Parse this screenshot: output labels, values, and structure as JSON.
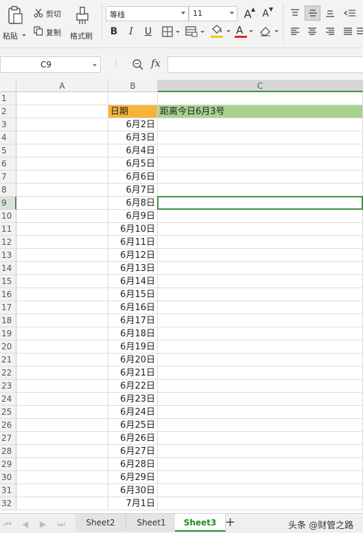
{
  "ribbon": {
    "paste_label": "粘贴",
    "cut_label": "剪切",
    "copy_label": "复制",
    "format_painter_label": "格式刷",
    "font_name": "等线",
    "font_size": "11",
    "bold": "B",
    "italic": "I",
    "underline": "U",
    "grow_font": "A",
    "shrink_font": "A",
    "font_color_glyph": "A",
    "fill_accent": "#f2c811",
    "font_color_accent": "#e02424"
  },
  "formula_bar": {
    "name_box": "C9",
    "fx": "fx",
    "formula": ""
  },
  "grid": {
    "columns": [
      "A",
      "B",
      "C"
    ],
    "selected_column": "C",
    "selected_cell": "C9",
    "header_fill_b2": "#f6b43c",
    "header_fill_c2": "#a9d18e",
    "rows": [
      {
        "n": "1",
        "b": "",
        "c": ""
      },
      {
        "n": "2",
        "b": "日期",
        "c": "距离今日6月3号"
      },
      {
        "n": "3",
        "b": "6月2日",
        "c": ""
      },
      {
        "n": "4",
        "b": "6月3日",
        "c": ""
      },
      {
        "n": "5",
        "b": "6月4日",
        "c": ""
      },
      {
        "n": "6",
        "b": "6月5日",
        "c": ""
      },
      {
        "n": "7",
        "b": "6月6日",
        "c": ""
      },
      {
        "n": "8",
        "b": "6月7日",
        "c": ""
      },
      {
        "n": "9",
        "b": "6月8日",
        "c": ""
      },
      {
        "n": "10",
        "b": "6月9日",
        "c": ""
      },
      {
        "n": "11",
        "b": "6月10日",
        "c": ""
      },
      {
        "n": "12",
        "b": "6月11日",
        "c": ""
      },
      {
        "n": "13",
        "b": "6月12日",
        "c": ""
      },
      {
        "n": "14",
        "b": "6月13日",
        "c": ""
      },
      {
        "n": "15",
        "b": "6月14日",
        "c": ""
      },
      {
        "n": "16",
        "b": "6月15日",
        "c": ""
      },
      {
        "n": "17",
        "b": "6月16日",
        "c": ""
      },
      {
        "n": "18",
        "b": "6月17日",
        "c": ""
      },
      {
        "n": "19",
        "b": "6月18日",
        "c": ""
      },
      {
        "n": "20",
        "b": "6月19日",
        "c": ""
      },
      {
        "n": "21",
        "b": "6月20日",
        "c": ""
      },
      {
        "n": "22",
        "b": "6月21日",
        "c": ""
      },
      {
        "n": "23",
        "b": "6月22日",
        "c": ""
      },
      {
        "n": "24",
        "b": "6月23日",
        "c": ""
      },
      {
        "n": "25",
        "b": "6月24日",
        "c": ""
      },
      {
        "n": "26",
        "b": "6月25日",
        "c": ""
      },
      {
        "n": "27",
        "b": "6月26日",
        "c": ""
      },
      {
        "n": "28",
        "b": "6月27日",
        "c": ""
      },
      {
        "n": "29",
        "b": "6月28日",
        "c": ""
      },
      {
        "n": "30",
        "b": "6月29日",
        "c": ""
      },
      {
        "n": "31",
        "b": "6月30日",
        "c": ""
      },
      {
        "n": "32",
        "b": "7月1日",
        "c": ""
      }
    ]
  },
  "sheets": {
    "tabs": [
      "Sheet2",
      "Sheet1",
      "Sheet3"
    ],
    "active": "Sheet3",
    "add": "+"
  },
  "watermark": "头条 @财管之路"
}
